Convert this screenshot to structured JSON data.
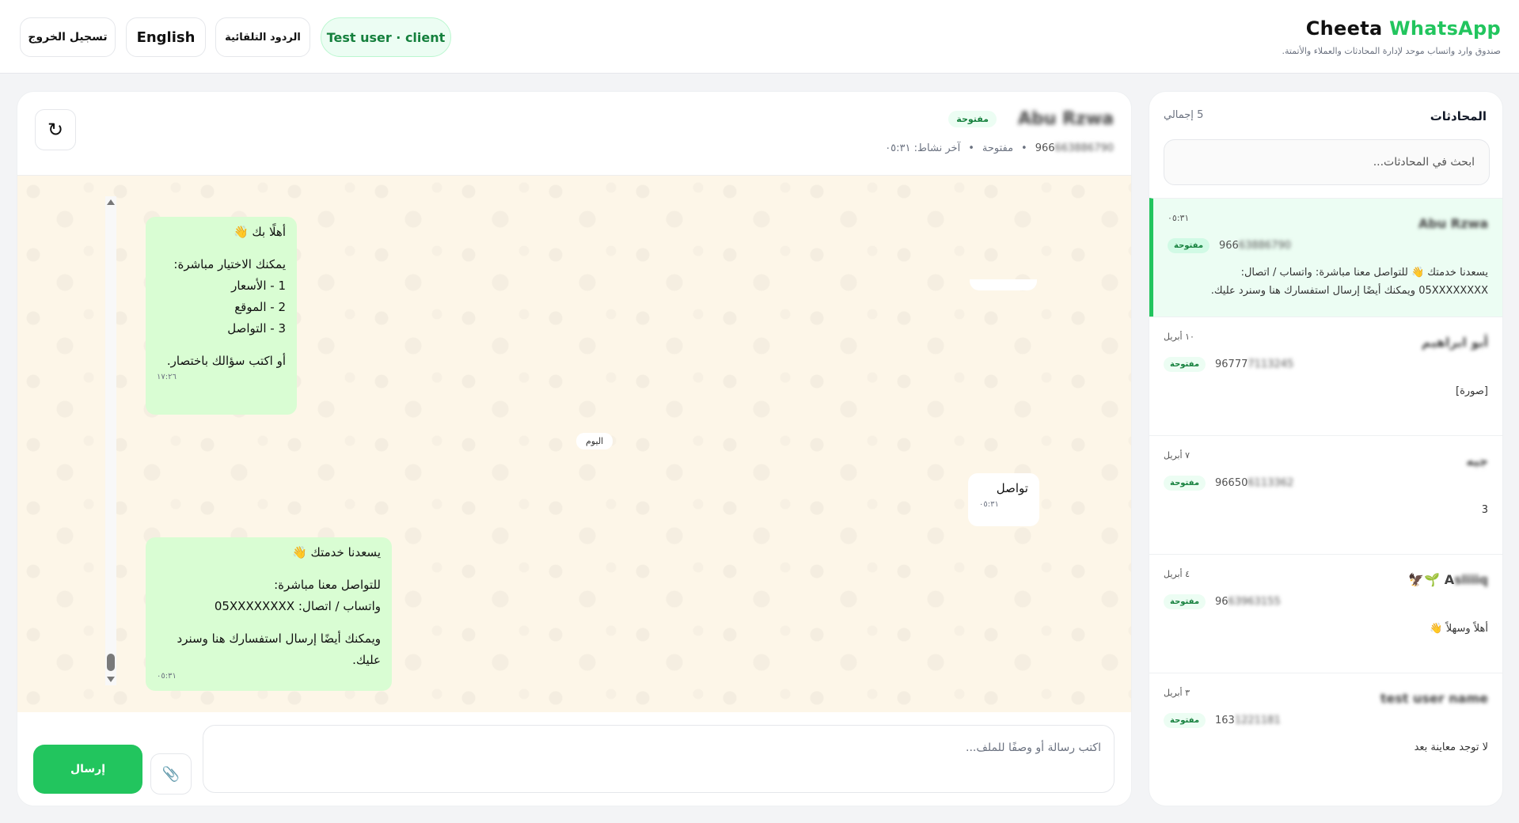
{
  "header": {
    "brand_prefix": "Cheeta ",
    "brand_accent": "WhatsApp",
    "subtitle": "صندوق وارد واتساب موحد لإدارة المحادثات والعملاء والأتمتة.",
    "user_label": "Test user · client",
    "quick_replies": "الردود التلقائية",
    "language": "English",
    "logout": "تسجيل الخروج"
  },
  "chat": {
    "contact_name": "Abu Rzwa",
    "status": "مفتوحة",
    "phone_prefix": "966",
    "phone_rest": "663886790",
    "meta_status": "مفتوحة",
    "last_active": "آخر نشاط: ٠٥:٣١",
    "refresh_icon": "↻",
    "day_separator": "اليوم",
    "messages": [
      {
        "text_l1": "أهلًا بك 👋",
        "text_l2": "يمكنك الاختيار مباشرة:",
        "text_l3": "1 - الأسعار",
        "text_l4": "2 - الموقع",
        "text_l5": "3 - التواصل",
        "text_l6": "أو اكتب سؤالك باختصار.",
        "time": "١٧:٢٦"
      },
      {
        "text": "تواصل",
        "time": "٠٥:٣١"
      },
      {
        "text_l1": "يسعدنا خدمتك 👋",
        "text_l2": "للتواصل معنا مباشرة:",
        "text_l3": "واتساب / اتصال: 05XXXXXXXX",
        "text_l4": "ويمكنك أيضًا إرسال استفسارك هنا وسنرد عليك.",
        "time": "٠٥:٣١"
      }
    ],
    "composer_placeholder": "اكتب رسالة أو وصفًا للملف...",
    "send_label": "إرسال",
    "attach_icon": "📎"
  },
  "sidebar": {
    "title": "المحادثات",
    "count": "5 إجمالي",
    "search_placeholder": "ابحث في المحادثات...",
    "conversations": [
      {
        "name": "Abu Rzwa",
        "time": "٠٥:٣١",
        "badge": "مفتوحة",
        "phone_prefix": "966",
        "phone_rest": "63886790",
        "preview_l1": "يسعدنا خدمتك 👋 للتواصل معنا مباشرة: واتساب / اتصال:",
        "preview_l2": "05XXXXXXXX ويمكنك أيضًا إرسال استفسارك هنا وسنرد عليك."
      },
      {
        "name": "أبو ابراهيم",
        "time": "١٠ أبريل",
        "badge": "مفتوحة",
        "phone_prefix": "96777",
        "phone_rest": "7113245",
        "preview_l1": "[صورة]"
      },
      {
        "name": "جيه",
        "time": "٧ أبريل",
        "badge": "مفتوحة",
        "phone_prefix": "96650",
        "phone_rest": "6113362",
        "preview_l1": "3"
      },
      {
        "name_emoji": "🦅🌱",
        "name_clear": "A",
        "name_blur": "sliiiq",
        "time": "٤ أبريل",
        "badge": "مفتوحة",
        "phone_prefix": "96",
        "phone_rest": "63963155",
        "preview_l1": "أهلاً وسهلاً 👋"
      },
      {
        "name": "test user name",
        "time": "٣ أبريل",
        "badge": "مفتوحة",
        "phone_prefix": "163",
        "phone_rest": "1221181",
        "preview_l1": "لا توجد معاينة بعد"
      }
    ]
  },
  "colors": {
    "accent": "#22c55e",
    "bubble_out": "#d9fdd3",
    "chat_bg": "#fdf6e8"
  }
}
